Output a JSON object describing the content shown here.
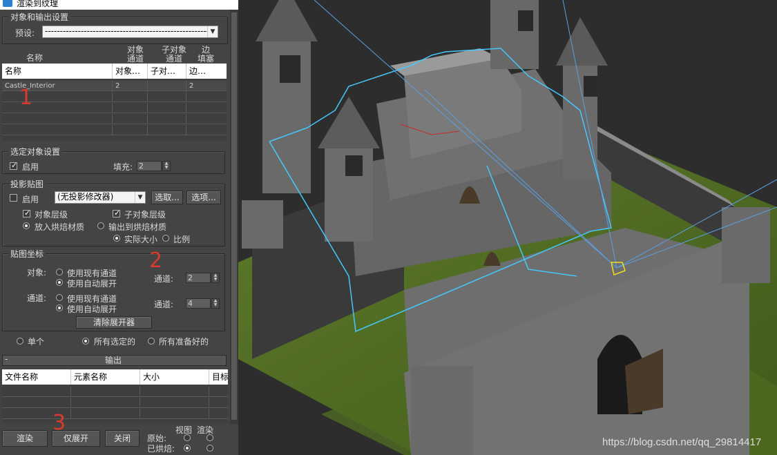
{
  "window": {
    "title": "渲染到纹理"
  },
  "object_output_settings": {
    "group_title": "对象和输出设置",
    "preset_label": "预设:",
    "preset_value": "-----------------------------------------------------------",
    "col_headers_top": {
      "name": "名称",
      "obj_channel": "对象\n通道",
      "sub_obj_channel": "子对象\n通道",
      "edge_padding": "边\n填塞"
    },
    "table": {
      "columns": [
        "名称",
        "对象…",
        "子对…",
        "边…"
      ],
      "rows": [
        [
          "Castle_Interior",
          "2",
          "",
          "2"
        ]
      ]
    }
  },
  "selected_object_settings": {
    "group_title": "选定对象设置",
    "enable_label": "启用",
    "padding_label": "填充:",
    "padding_value": "2"
  },
  "projection_mapping": {
    "group_title": "投影贴图",
    "enable_label": "启用",
    "modifier_value": "(无投影修改器)",
    "pick_button": "选取...",
    "options_button": "选项...",
    "object_level": "对象层级",
    "sub_object_level": "子对象层级",
    "put_to_baked": "放入烘焙材质",
    "output_to_baked": "输出到烘焙材质",
    "actual_size": "实际大小",
    "proportion": "比例"
  },
  "mapping_coordinates": {
    "group_title": "贴图坐标",
    "object_label": "对象:",
    "channel_label": "通道:",
    "use_existing": "使用现有通道",
    "use_auto_unwrap": "使用自动展开",
    "channel_field_label": "通道:",
    "object_channel_value": "2",
    "sub_channel_value": "4",
    "clear_unwrapper": "清除展开器"
  },
  "scope": {
    "single": "单个",
    "all_selected": "所有选定的",
    "all_prepared": "所有准备好的"
  },
  "output": {
    "rollout_minus": "-",
    "rollout_title": "输出",
    "columns": [
      "文件名称",
      "元素名称",
      "大小",
      "目标"
    ]
  },
  "bottom": {
    "render_button": "渲染",
    "unwrap_only_button": "仅展开",
    "close_button": "关闭",
    "view_label": "视图",
    "render_label": "渲染",
    "original_label": "原始:",
    "baked_label": "已烘焙:"
  },
  "annotations": {
    "mark1": "1",
    "mark2": "2",
    "mark3": "3"
  },
  "watermark": "https://blog.csdn.net/qq_29814417"
}
